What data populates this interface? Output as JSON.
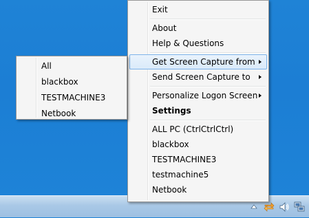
{
  "main_menu": {
    "items": [
      {
        "label": "Exit"
      },
      {
        "label": "About"
      },
      {
        "label": "Help & Questions"
      },
      {
        "label": "Get Screen Capture from"
      },
      {
        "label": "Send Screen Capture to"
      },
      {
        "label": "Personalize Logon Screen"
      },
      {
        "label": "Settings"
      },
      {
        "label": "ALL PC (CtrlCtrlCtrl)"
      },
      {
        "label": "blackbox"
      },
      {
        "label": "TESTMACHINE3"
      },
      {
        "label": "testmachine5"
      },
      {
        "label": "Netbook"
      }
    ]
  },
  "sub_menu": {
    "items": [
      {
        "label": "All"
      },
      {
        "label": "blackbox"
      },
      {
        "label": "TESTMACHINE3"
      },
      {
        "label": "Netbook"
      }
    ]
  },
  "tray": {
    "icons": [
      "show-hidden-icons-arrow",
      "app-swap-icon",
      "volume-icon",
      "network-icon"
    ]
  },
  "colors": {
    "desktop": "#1c7ed4",
    "menu_bg": "#f5f5f5",
    "highlight_border": "#7eb4ea",
    "highlight_bg": "#d9eafa",
    "app_icon_orange": "#f0a030"
  }
}
